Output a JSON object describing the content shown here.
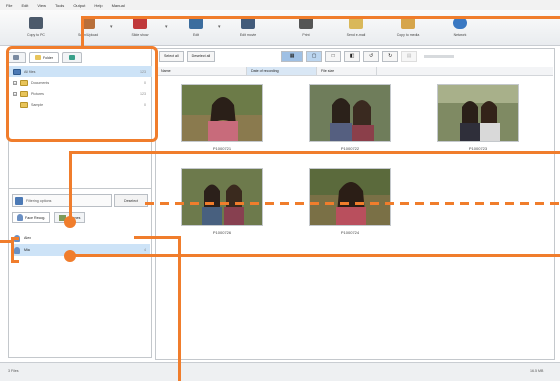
{
  "menu": [
    "File",
    "Edit",
    "View",
    "Tools",
    "Output",
    "Help",
    "Manual"
  ],
  "toolbar": [
    {
      "label": "Copy to PC",
      "icon": "camera-pc-icon",
      "color": "#4c5a6b"
    },
    {
      "label": "Scan/Upload",
      "icon": "upload-icon",
      "color": "#b86f3a"
    },
    {
      "label": "Slide show",
      "icon": "slideshow-icon",
      "color": "#c0393b"
    },
    {
      "label": "Edit",
      "icon": "edit-icon",
      "color": "#3c6d9e"
    },
    {
      "label": "Edit movie",
      "icon": "movie-icon",
      "color": "#425b7a"
    },
    {
      "label": "Print",
      "icon": "printer-icon",
      "color": "#555555"
    },
    {
      "label": "Send e-mail",
      "icon": "mail-icon",
      "color": "#d9b85a"
    },
    {
      "label": "Copy to media",
      "icon": "media-icon",
      "color": "#d6a54b"
    },
    {
      "label": "Network",
      "icon": "globe-icon",
      "color": "#3a78c2"
    }
  ],
  "tabs": [
    {
      "label": "",
      "icon": "calendar-icon"
    },
    {
      "label": "Folder",
      "icon": "folder-icon"
    },
    {
      "label": "",
      "icon": "album-icon"
    }
  ],
  "tree": [
    {
      "label": "All files",
      "count": "123",
      "selected": true
    },
    {
      "label": "Documents",
      "count": "0",
      "selected": false
    },
    {
      "label": "Pictures",
      "count": "123",
      "selected": false
    },
    {
      "label": "Sample",
      "count": "0",
      "selected": false
    }
  ],
  "filter": {
    "label": "Filtering options",
    "deselect": "Deselect"
  },
  "face_tabs": [
    {
      "label": "Face Recog.",
      "active": true
    },
    {
      "label": "Scenes",
      "active": false
    }
  ],
  "people": [
    {
      "label": "Alex",
      "count": "10",
      "selected": false
    },
    {
      "label": "Mia",
      "count": "4",
      "selected": true
    }
  ],
  "right": {
    "select_all": "Select all",
    "deselect_all": "Deselect all",
    "columns": [
      "Name",
      "Date of recording",
      "File size"
    ]
  },
  "thumbs": [
    {
      "caption": "P1000721"
    },
    {
      "caption": "P1000722"
    },
    {
      "caption": "P1000723"
    },
    {
      "caption": "P1000726"
    },
    {
      "caption": "P1000724"
    }
  ],
  "status": {
    "left": "3 Files",
    "right": "16.5 MB"
  },
  "colors": {
    "callout": "#f07d2c",
    "selection": "#cde3f7"
  }
}
